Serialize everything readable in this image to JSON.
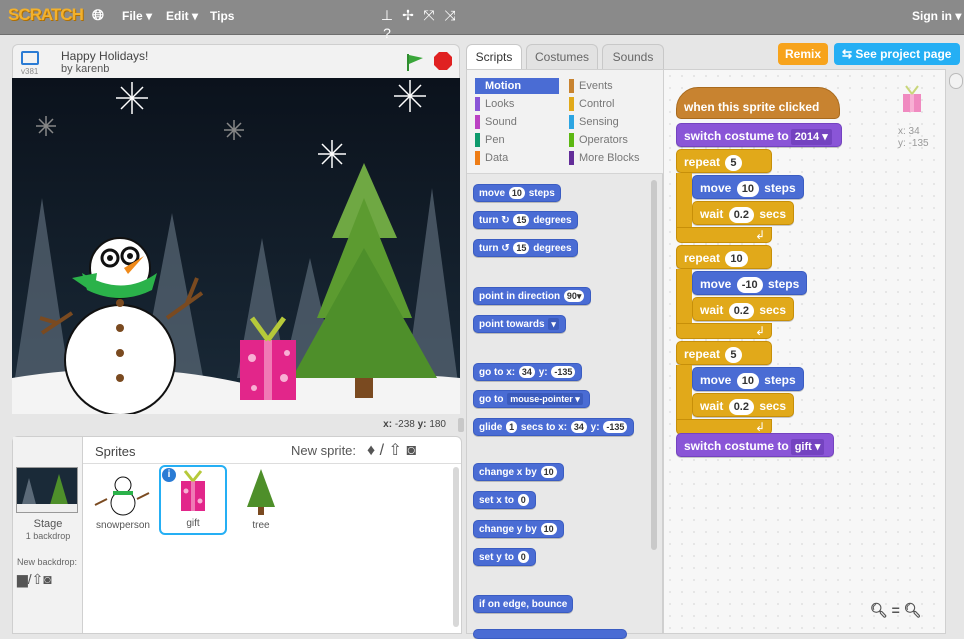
{
  "menubar": {
    "logo": "SCRATCH",
    "file": "File ▾",
    "edit": "Edit ▾",
    "tips": "Tips",
    "signin": "Sign in ▾"
  },
  "project": {
    "title": "Happy Holidays!",
    "author": "by karenb",
    "version": "v381"
  },
  "stage_footer": {
    "x_label": "x:",
    "x_value": "-238",
    "y_label": "y:",
    "y_value": "180"
  },
  "sprites_panel": {
    "title": "Sprites",
    "new_sprite": "New sprite:",
    "stage_label": "Stage",
    "stage_sub": "1 backdrop",
    "new_backdrop": "New backdrop:",
    "items": [
      {
        "name": "snowperson"
      },
      {
        "name": "gift"
      },
      {
        "name": "tree"
      }
    ]
  },
  "tabs": [
    "Scripts",
    "Costumes",
    "Sounds"
  ],
  "buttons": {
    "remix": "Remix",
    "see_project": "See project page"
  },
  "categories": [
    {
      "label": "Motion",
      "color": "#4a6cd4"
    },
    {
      "label": "Looks",
      "color": "#8a55d7"
    },
    {
      "label": "Sound",
      "color": "#bb42c3"
    },
    {
      "label": "Pen",
      "color": "#0e9a6c"
    },
    {
      "label": "Data",
      "color": "#ee7d16"
    },
    {
      "label": "Events",
      "color": "#c88330"
    },
    {
      "label": "Control",
      "color": "#e1a91a"
    },
    {
      "label": "Sensing",
      "color": "#2ca5e2"
    },
    {
      "label": "Operators",
      "color": "#5cb712"
    },
    {
      "label": "More Blocks",
      "color": "#632d99"
    }
  ],
  "palette": {
    "move_pre": "move",
    "move_num": "10",
    "move_post": "steps",
    "turn_r_pre": "turn",
    "turn_r_num": "15",
    "turn_r_post": "degrees",
    "turn_l_pre": "turn",
    "turn_l_num": "15",
    "turn_l_post": "degrees",
    "point_dir": "point in direction",
    "point_dir_val": "90▾",
    "point_towards": "point towards",
    "goto_xy": "go to x:",
    "goto_x": "34",
    "goto_y_label": "y:",
    "goto_y": "-135",
    "goto": "go to",
    "goto_target": "mouse-pointer ▾",
    "glide_pre": "glide",
    "glide_num": "1",
    "glide_mid": "secs to x:",
    "glide_x": "34",
    "glide_y_label": "y:",
    "glide_y": "-135",
    "change_x": "change x by",
    "change_x_val": "10",
    "set_x": "set x to",
    "set_x_val": "0",
    "change_y": "change y by",
    "change_y_val": "10",
    "set_y": "set y to",
    "set_y_val": "0",
    "bounce": "if on edge, bounce"
  },
  "script": {
    "hat": "when this sprite clicked",
    "switch1": "switch costume to",
    "switch1_val": "2014 ▾",
    "repeat1": "repeat",
    "repeat1_val": "5",
    "move1": "move",
    "move1_val": "10",
    "move1_post": "steps",
    "wait1": "wait",
    "wait1_val": "0.2",
    "wait1_post": "secs",
    "repeat2": "repeat",
    "repeat2_val": "10",
    "move2": "move",
    "move2_val": "-10",
    "move2_post": "steps",
    "wait2": "wait",
    "wait2_val": "0.2",
    "wait2_post": "secs",
    "repeat3": "repeat",
    "repeat3_val": "5",
    "move3": "move",
    "move3_val": "10",
    "move3_post": "steps",
    "wait3": "wait",
    "wait3_val": "0.2",
    "wait3_post": "secs",
    "switch2": "switch costume to",
    "switch2_val": "gift ▾",
    "sprite_x": "x: 34",
    "sprite_y": "y: -135"
  }
}
